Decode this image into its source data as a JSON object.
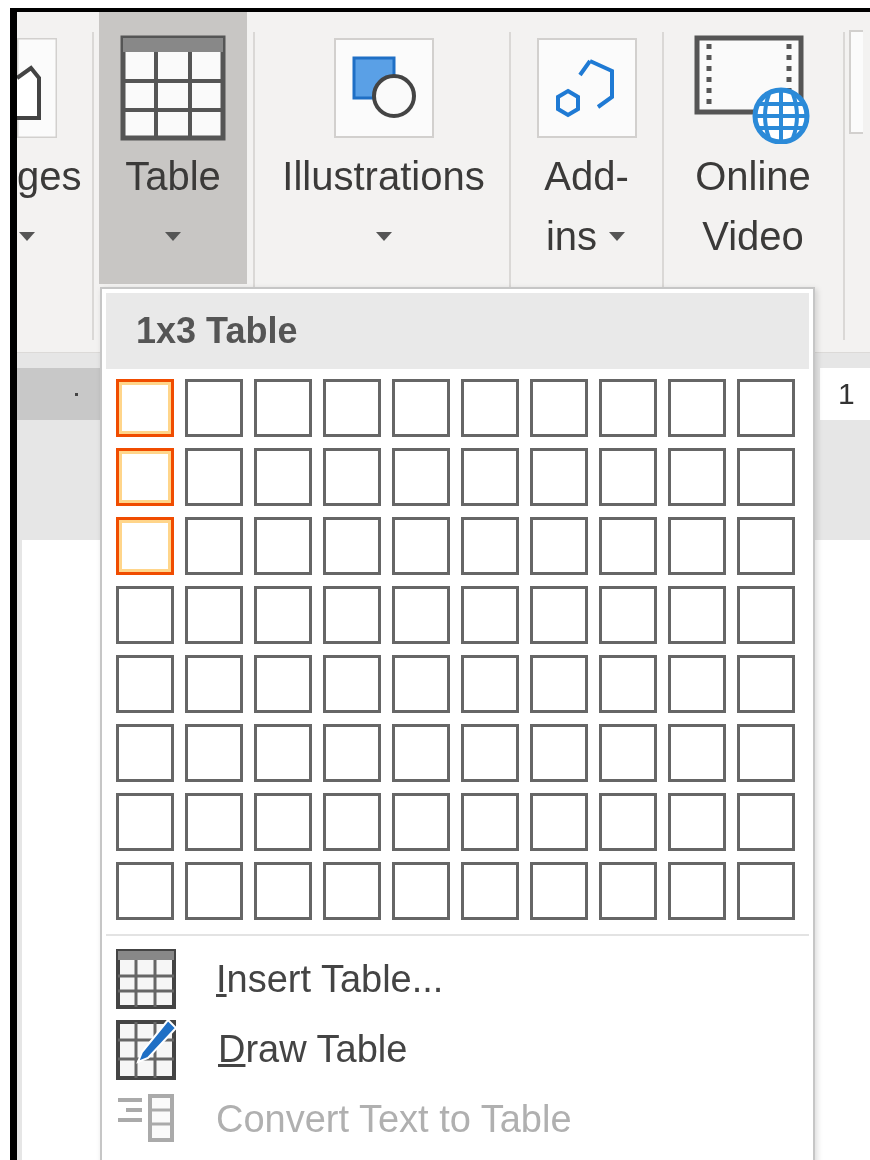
{
  "ribbon": {
    "buttons": [
      {
        "kind": "partial",
        "lines": [
          "ges"
        ],
        "selected": false
      },
      {
        "kind": "table",
        "lines": [
          "Table"
        ],
        "selected": true
      },
      {
        "kind": "shapes",
        "lines": [
          "Illustrations"
        ],
        "selected": false
      },
      {
        "kind": "addins",
        "lines": [
          "Add-",
          "ins"
        ],
        "selected": false
      },
      {
        "kind": "video",
        "lines": [
          "Online",
          "Video"
        ],
        "selected": false
      }
    ]
  },
  "ruler": {
    "mark": "1"
  },
  "table_menu": {
    "header": "1x3 Table",
    "grid": [
      {
        "cells": [
          {
            "selected": true
          },
          {
            "selected": false
          },
          {
            "selected": false
          },
          {
            "selected": false
          },
          {
            "selected": false
          },
          {
            "selected": false
          },
          {
            "selected": false
          },
          {
            "selected": false
          },
          {
            "selected": false
          },
          {
            "selected": false
          }
        ]
      },
      {
        "cells": [
          {
            "selected": true
          },
          {
            "selected": false
          },
          {
            "selected": false
          },
          {
            "selected": false
          },
          {
            "selected": false
          },
          {
            "selected": false
          },
          {
            "selected": false
          },
          {
            "selected": false
          },
          {
            "selected": false
          },
          {
            "selected": false
          }
        ]
      },
      {
        "cells": [
          {
            "selected": true
          },
          {
            "selected": false
          },
          {
            "selected": false
          },
          {
            "selected": false
          },
          {
            "selected": false
          },
          {
            "selected": false
          },
          {
            "selected": false
          },
          {
            "selected": false
          },
          {
            "selected": false
          },
          {
            "selected": false
          }
        ]
      },
      {
        "cells": [
          {
            "selected": false
          },
          {
            "selected": false
          },
          {
            "selected": false
          },
          {
            "selected": false
          },
          {
            "selected": false
          },
          {
            "selected": false
          },
          {
            "selected": false
          },
          {
            "selected": false
          },
          {
            "selected": false
          },
          {
            "selected": false
          }
        ]
      },
      {
        "cells": [
          {
            "selected": false
          },
          {
            "selected": false
          },
          {
            "selected": false
          },
          {
            "selected": false
          },
          {
            "selected": false
          },
          {
            "selected": false
          },
          {
            "selected": false
          },
          {
            "selected": false
          },
          {
            "selected": false
          },
          {
            "selected": false
          }
        ]
      },
      {
        "cells": [
          {
            "selected": false
          },
          {
            "selected": false
          },
          {
            "selected": false
          },
          {
            "selected": false
          },
          {
            "selected": false
          },
          {
            "selected": false
          },
          {
            "selected": false
          },
          {
            "selected": false
          },
          {
            "selected": false
          },
          {
            "selected": false
          }
        ]
      },
      {
        "cells": [
          {
            "selected": false
          },
          {
            "selected": false
          },
          {
            "selected": false
          },
          {
            "selected": false
          },
          {
            "selected": false
          },
          {
            "selected": false
          },
          {
            "selected": false
          },
          {
            "selected": false
          },
          {
            "selected": false
          },
          {
            "selected": false
          }
        ]
      },
      {
        "cells": [
          {
            "selected": false
          },
          {
            "selected": false
          },
          {
            "selected": false
          },
          {
            "selected": false
          },
          {
            "selected": false
          },
          {
            "selected": false
          },
          {
            "selected": false
          },
          {
            "selected": false
          },
          {
            "selected": false
          },
          {
            "selected": false
          }
        ]
      }
    ],
    "items": [
      {
        "kind": "insert",
        "label": "Insert Table...",
        "access_key_underlined": true,
        "disabled": false
      },
      {
        "kind": "draw",
        "label": "Draw Table",
        "access_key_underlined": true,
        "disabled": false
      },
      {
        "kind": "convert",
        "label": "Convert Text to Table",
        "access_key_underlined": false,
        "disabled": true
      }
    ]
  }
}
